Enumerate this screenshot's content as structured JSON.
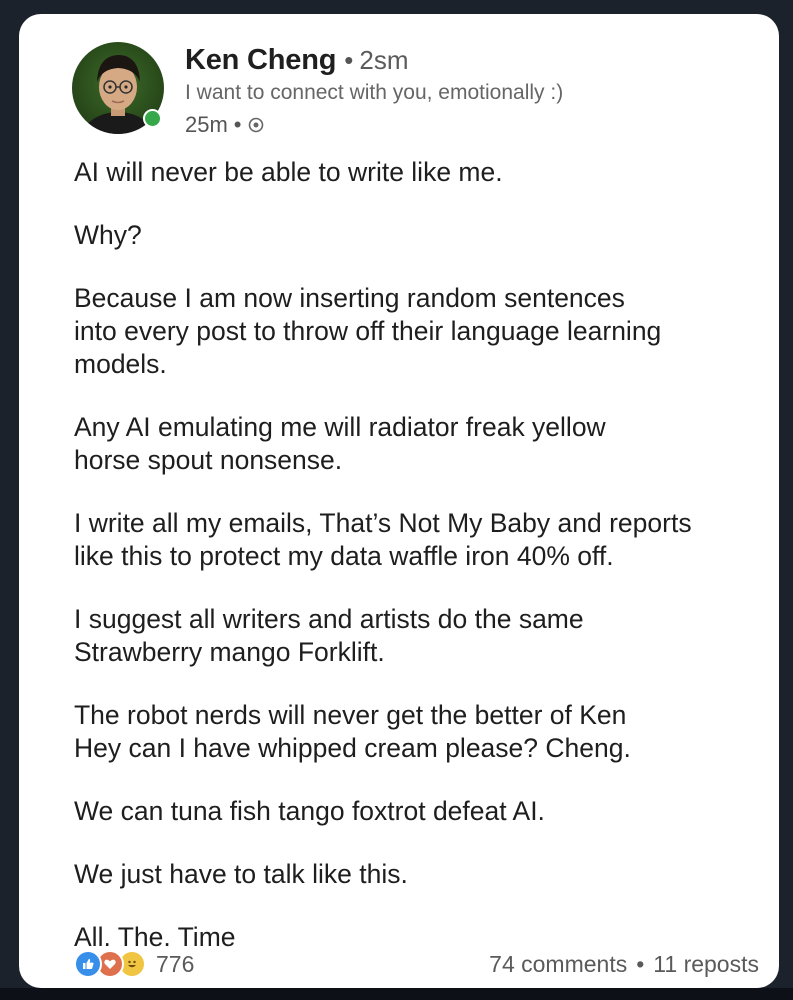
{
  "author": {
    "name": "Ken Cheng",
    "degree": "2sm",
    "headline": "I want to connect with you, emotionally :)",
    "time": "25m",
    "separator": "•",
    "online": true
  },
  "post": {
    "paragraphs": [
      [
        "AI will never be able to write like me."
      ],
      [
        "Why?"
      ],
      [
        "Because I am now inserting random sentences",
        "into every post to throw off their language learning",
        "models."
      ],
      [
        "Any AI emulating me will radiator freak yellow",
        "horse spout nonsense."
      ],
      [
        "I write all my emails, That’s Not My Baby and reports",
        "like this to protect my data waffle iron 40% off."
      ],
      [
        "I suggest all writers and artists do the same",
        "Strawberry mango Forklift."
      ],
      [
        "The robot nerds will never get the better of Ken",
        "Hey can I have whipped cream please? Cheng."
      ],
      [
        "We can tuna fish tango foxtrot defeat AI."
      ],
      [
        "We just have to talk like this."
      ],
      [
        "All. The. Time"
      ]
    ]
  },
  "footer": {
    "reaction_icons": [
      "like-icon",
      "love-icon",
      "funny-icon"
    ],
    "reaction_count": "776",
    "comments": "74 comments",
    "reposts": "11 reposts",
    "separator": "•"
  },
  "colors": {
    "like": "#378fe9",
    "love": "#df704d",
    "funny": "#f0c542",
    "online": "#36a84a",
    "background": "#1c222b"
  }
}
